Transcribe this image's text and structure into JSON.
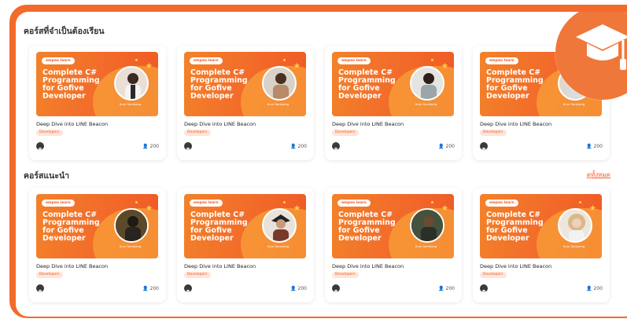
{
  "sections": [
    {
      "title": "คอร์สที่จำเป็นต้องเรียน",
      "courses": [
        {
          "title": "Deep Dive into LINE Beacon",
          "tag": "Developers",
          "count": "200"
        },
        {
          "title": "Deep Dive into LINE Beacon",
          "tag": "Developers",
          "count": "200"
        },
        {
          "title": "Deep Dive into LINE Beacon",
          "tag": "Developers",
          "count": "200"
        },
        {
          "title": "Deep Dive into LINE Beacon",
          "tag": "Developers",
          "count": "200"
        }
      ]
    },
    {
      "title": "คอร์สแนะนำ",
      "see_all": "ดูทั้งหมด",
      "courses": [
        {
          "title": "Deep Dive into LINE Beacon",
          "tag": "Developers",
          "count": "200"
        },
        {
          "title": "Deep Dive into LINE Beacon",
          "tag": "Developers",
          "count": "200"
        },
        {
          "title": "Deep Dive into LINE Beacon",
          "tag": "Developers",
          "count": "200"
        },
        {
          "title": "Deep Dive into LINE Beacon",
          "tag": "Developers",
          "count": "200"
        }
      ]
    }
  ],
  "banner": {
    "brand": "empeo learn",
    "title": "Complete C# Programming for Gofive Developer",
    "author": "Kum Somkang"
  },
  "icons": {
    "graduation": "graduation-cap-icon",
    "person": "person-icon",
    "star": "star-icon"
  },
  "colors": {
    "accent": "#f26b2a",
    "tag_bg": "#fde5da",
    "star": "#ffd04a"
  }
}
